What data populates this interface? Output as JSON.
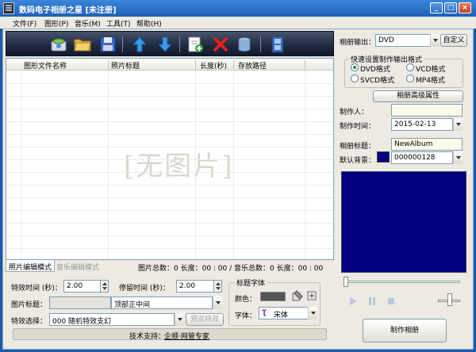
{
  "window": {
    "title": "数码电子相册之星 [未注册]",
    "controls": {
      "minimize": "_",
      "maximize": "□",
      "close": "×"
    }
  },
  "menu": [
    {
      "label": "文件(F)"
    },
    {
      "label": "图形(P)"
    },
    {
      "label": "音乐(M)"
    },
    {
      "label": "工具(T)"
    },
    {
      "label": "帮助(H)"
    }
  ],
  "toolbar": {
    "icons": [
      "scan-icon",
      "open-folder-icon",
      "save-icon",
      "move-up-icon",
      "move-down-icon",
      "add-image-icon",
      "delete-icon",
      "clear-icon",
      "film-icon"
    ]
  },
  "file_list": {
    "columns": [
      "图形文件名称",
      "照片标题",
      "长度(秒)",
      "存放路径"
    ],
    "rows": [],
    "placeholder": "[无图片]"
  },
  "tabs": [
    {
      "label": "照片编辑模式",
      "active": true
    },
    {
      "label": "音乐编辑模式",
      "active": false
    }
  ],
  "stats": {
    "text": "图片总数：0  长度：00 : 00  /  音乐总数：0  长度：00 : 00"
  },
  "photo_edit": {
    "effect_time_label": "特效时间 (秒)：",
    "effect_time_value": "2.00",
    "stay_time_label": "停留时间 (秒)：",
    "stay_time_value": "2.00",
    "title_label": "图片标题：",
    "title_value": "",
    "title_position": "顶部正中间",
    "effect_label": "特效选择：",
    "effect_value": "000 随机特效支幻",
    "preview_effect_button": "预览特效"
  },
  "title_font": {
    "group_label": "标题字体",
    "color_label": "颜色：",
    "color_value": "#555555",
    "font_label": "字体：",
    "font_value": "宋体"
  },
  "support": {
    "label": "技术支持：",
    "link": "企顺·网管专家"
  },
  "album": {
    "output_label": "相册输出：",
    "output_value": "DVD",
    "custom_button": "自定义",
    "quick_format_title": "快速设置制作输出格式",
    "formats": [
      {
        "label": "DVD格式",
        "checked": true
      },
      {
        "label": "VCD格式",
        "checked": false
      },
      {
        "label": "SVCD格式",
        "checked": false
      },
      {
        "label": "MP4格式",
        "checked": false
      }
    ],
    "advanced_button": "相册高级属性",
    "author_label": "制作人：",
    "author_value": "",
    "date_label": "制作时间：",
    "date_value": "2015-02-13",
    "album_title_label": "相册标题：",
    "album_title_value": "NewAlbum",
    "bg_label": "默认背景：",
    "bg_value": "000000128",
    "bg_color": "#000080",
    "make_button": "制作相册"
  },
  "player": {
    "position": 0.0,
    "volume": 0.55
  }
}
